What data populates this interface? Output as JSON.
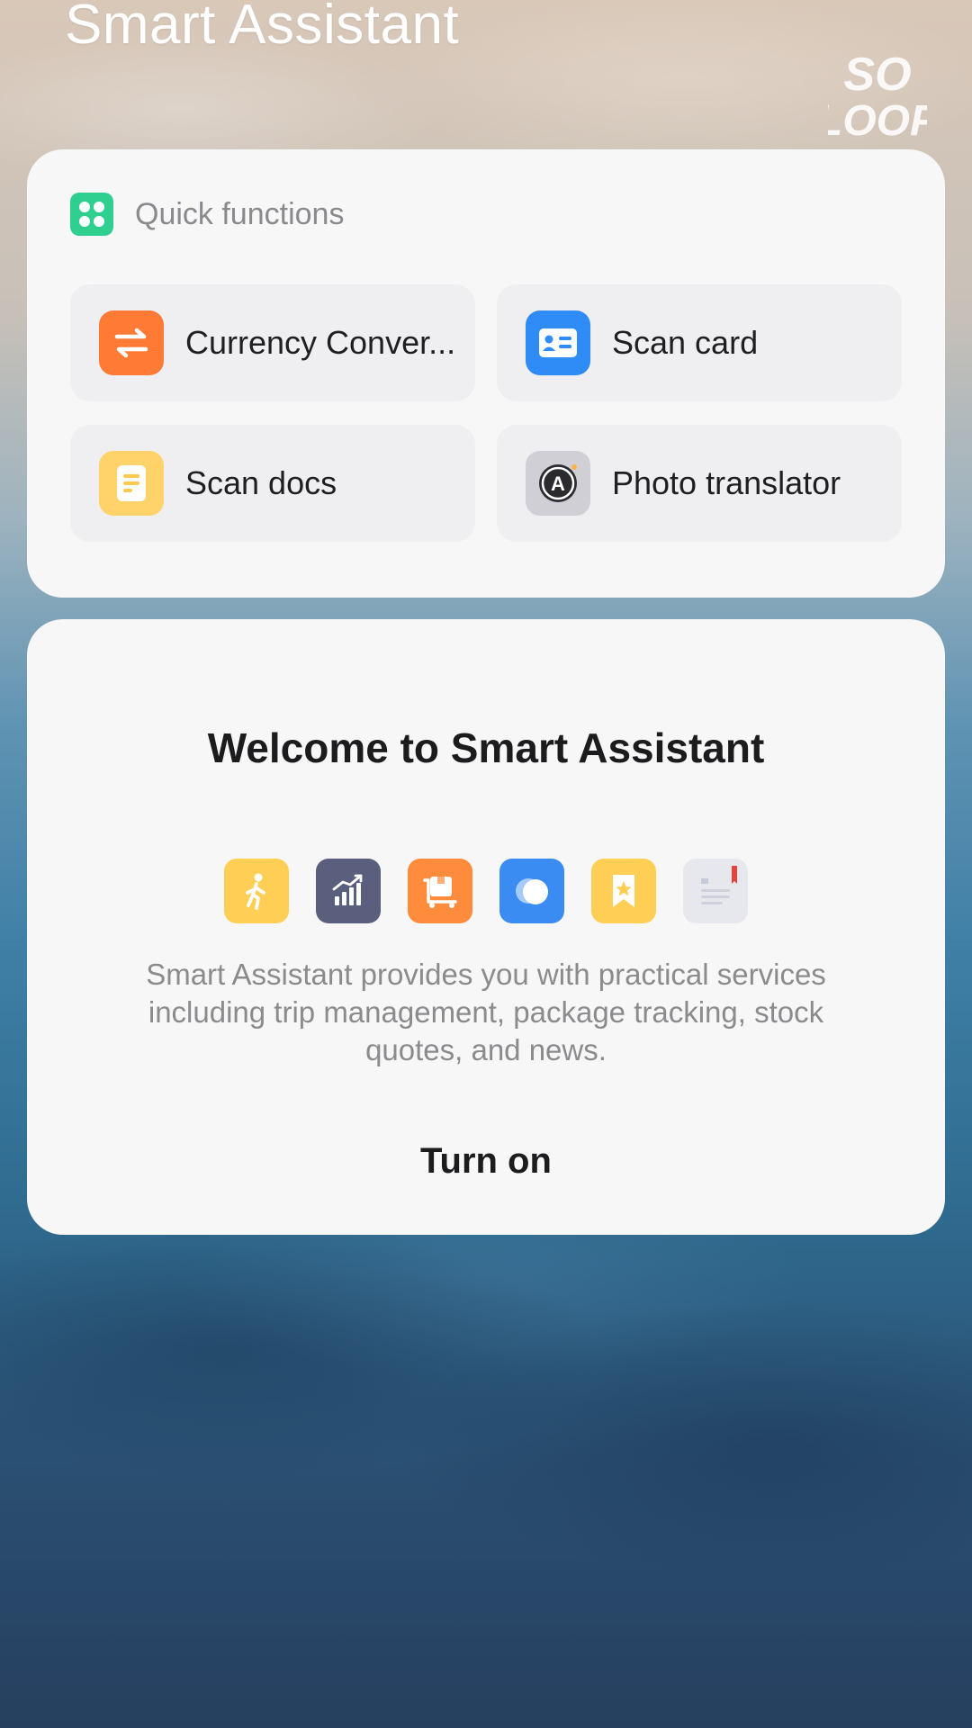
{
  "header": {
    "title": "Smart Assistant"
  },
  "watermark": {
    "text": "SO LOOP"
  },
  "quick_functions": {
    "title": "Quick functions",
    "icon": "grid-apps-icon",
    "items": [
      {
        "label": "Currency Conver...",
        "icon": "currency-exchange-icon",
        "color": "#ff7a35"
      },
      {
        "label": "Scan card",
        "icon": "id-card-icon",
        "color": "#2f8cf6"
      },
      {
        "label": "Scan docs",
        "icon": "document-icon",
        "color": "#ffd36a"
      },
      {
        "label": "Photo translator",
        "icon": "translate-icon",
        "color": "#cfcfd5"
      }
    ]
  },
  "welcome": {
    "title": "Welcome to Smart Assistant",
    "services": [
      {
        "icon": "walking-icon",
        "color": "#ffcf55"
      },
      {
        "icon": "stock-chart-icon",
        "color": "#5b5f7e"
      },
      {
        "icon": "package-icon",
        "color": "#ff8b3d"
      },
      {
        "icon": "weather-cloud-icon",
        "color": "#3a8cf2"
      },
      {
        "icon": "bookmark-star-icon",
        "color": "#ffcf55"
      },
      {
        "icon": "news-icon",
        "color": "#e7e8ee"
      }
    ],
    "description": "Smart Assistant provides you with practical services including trip management, package tracking, stock quotes, and news.",
    "button": "Turn on"
  }
}
